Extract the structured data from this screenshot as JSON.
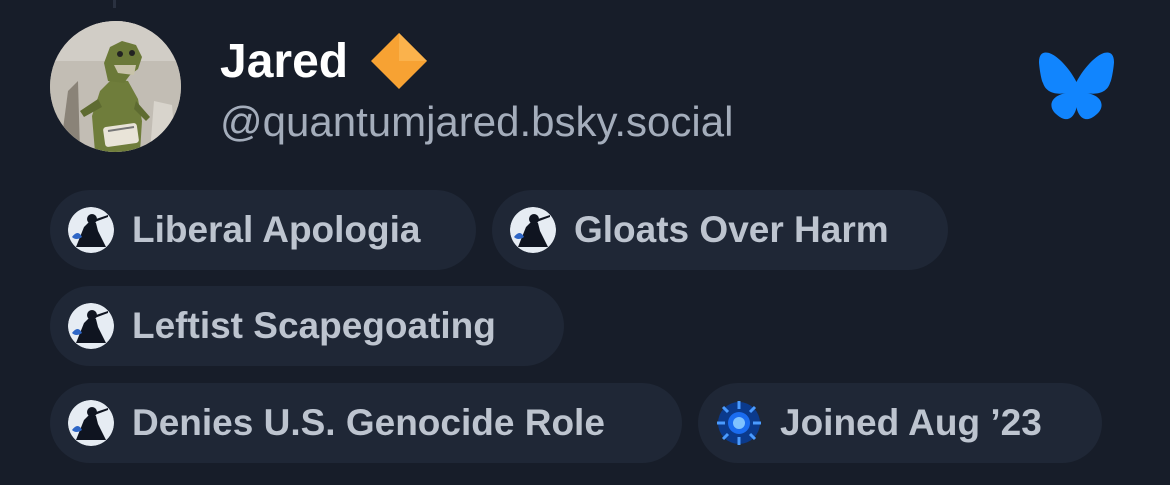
{
  "profile": {
    "display_name": "Jared",
    "handle": "@quantumjared.bsky.social",
    "verified_icon": "orange-diamond-icon",
    "avatar": "toy-dinosaur-photo",
    "platform_icon": "bluesky-butterfly-icon"
  },
  "badges": [
    {
      "label": "Liberal Apologia",
      "icon": "shadow-figure-icon"
    },
    {
      "label": "Gloats Over Harm",
      "icon": "shadow-figure-icon"
    },
    {
      "label": "Leftist Scapegoating",
      "icon": "shadow-figure-icon"
    },
    {
      "label": "Denies U.S. Genocide Role",
      "icon": "shadow-figure-icon"
    },
    {
      "label": "Joined Aug ’23",
      "icon": "blue-sun-icon"
    }
  ],
  "colors": {
    "background": "#171d29",
    "pill_background": "#1f2736",
    "bluesky_blue": "#1185fe",
    "diamond_orange": "#f7a233",
    "handle_text": "#a4adbb",
    "pill_text": "#bdc4cf"
  }
}
